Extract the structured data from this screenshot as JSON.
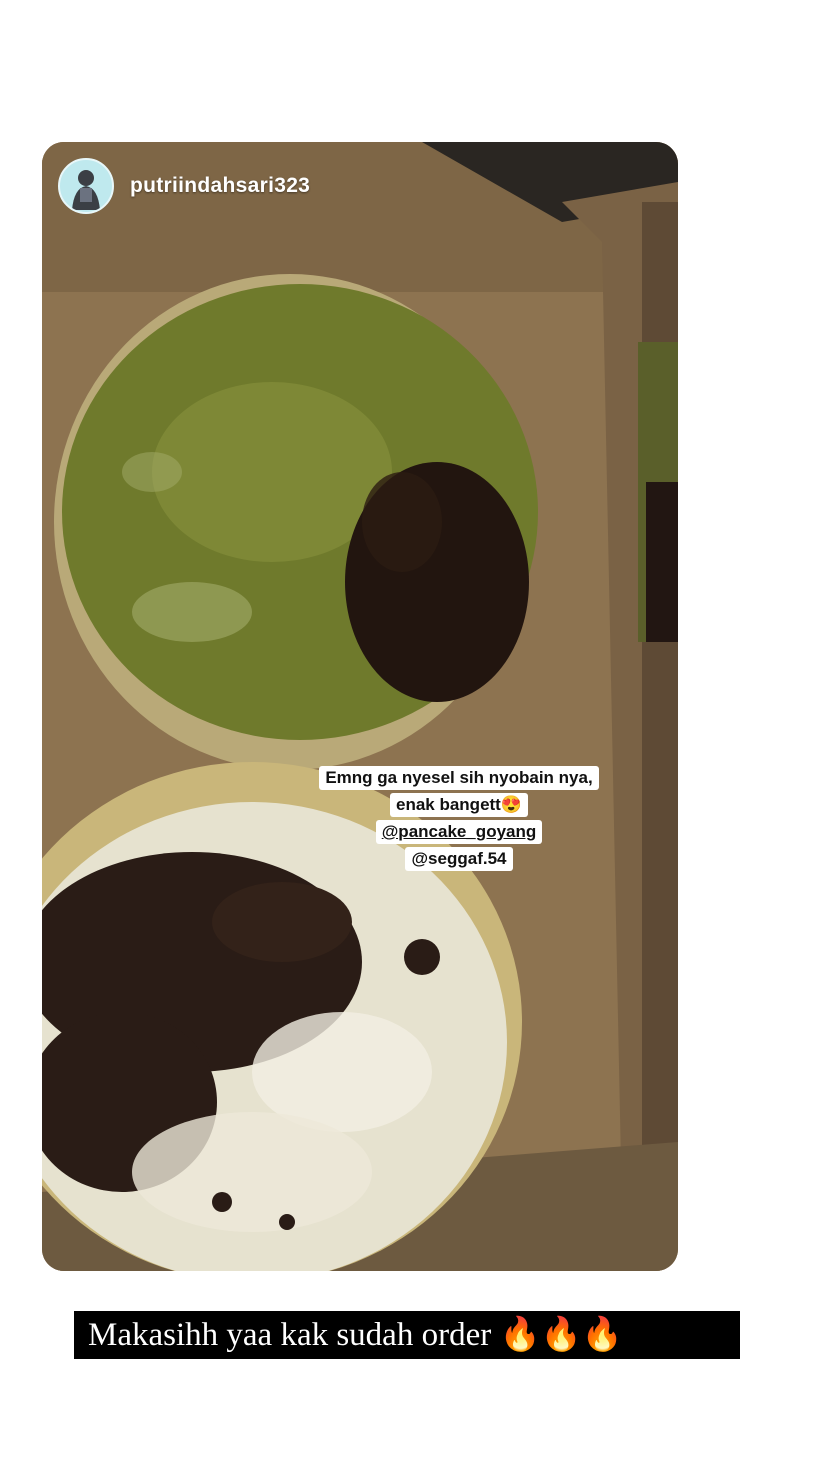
{
  "story": {
    "username": "putriindahsari323",
    "sticker_lines": [
      "Emng ga nyesel sih nyobain nya,",
      "enak bangett😍",
      "@pancake_goyang",
      "@seggaf.54"
    ]
  },
  "caption": "Makasihh yaa kak sudah order 🔥🔥🔥"
}
